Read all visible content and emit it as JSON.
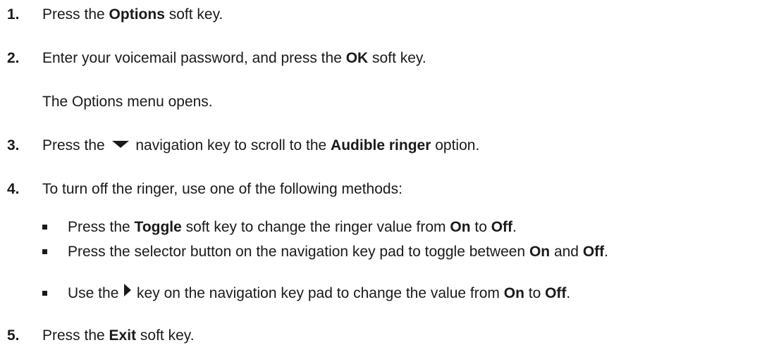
{
  "steps": [
    {
      "number": "1.",
      "parts": [
        "Press the ",
        "Options",
        " soft key."
      ]
    },
    {
      "number": "2.",
      "parts": [
        "Enter your voicemail password, and press the ",
        "OK",
        " soft key."
      ],
      "note": "The Options menu opens."
    },
    {
      "number": "3.",
      "parts": [
        "Press the ",
        " navigation key to scroll to the ",
        "Audible ringer",
        " option."
      ],
      "icon": "down-arrow-icon"
    },
    {
      "number": "4.",
      "parts": [
        "To turn off the ringer, use one of the following methods:"
      ]
    },
    {
      "number": "5.",
      "parts": [
        "Press the ",
        "Exit",
        " soft key."
      ]
    }
  ],
  "methods": [
    {
      "parts": [
        "Press the ",
        "Toggle",
        " soft key to change the ringer value from ",
        "On",
        " to ",
        "Off",
        "."
      ]
    },
    {
      "parts": [
        "Press the selector button on the navigation key pad to toggle between ",
        "On",
        " and ",
        "Off",
        "."
      ]
    },
    {
      "parts": [
        "Use the ",
        " key on the navigation key pad to change the value from ",
        "On",
        " to ",
        "Off",
        "."
      ],
      "icon": "right-arrow-icon"
    }
  ]
}
